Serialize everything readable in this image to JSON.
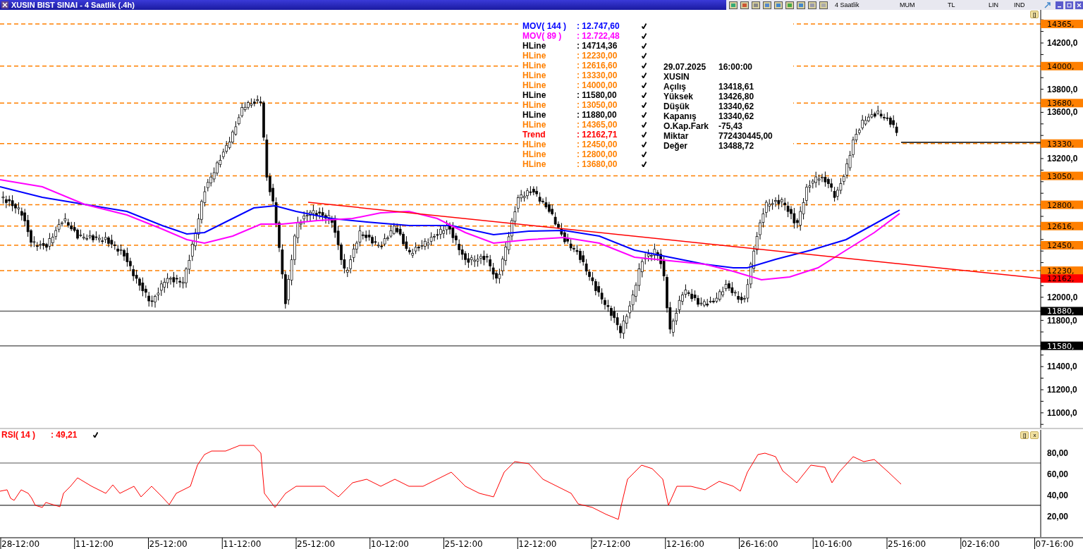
{
  "window": {
    "title": "XUSIN BIST SINAI - 4 Saatlik (.4h)"
  },
  "toolbar": {
    "items": [
      "4 Saatlik",
      "MUM",
      "TL",
      "LIN",
      "IND"
    ]
  },
  "price_panel": {
    "legend": [
      {
        "kind": "mov",
        "name": "MOV( 144 )",
        "value": ": 12.747,60",
        "color": "#0000ff"
      },
      {
        "kind": "mov",
        "name": "MOV( 89 )",
        "value": ": 12.722,48",
        "color": "#ff00ff"
      },
      {
        "kind": "hline",
        "name": "HLine",
        "value": ": 14714,36",
        "color": "#000000"
      },
      {
        "kind": "hline",
        "name": "HLine",
        "value": ": 12230,00",
        "color": "#ff8000"
      },
      {
        "kind": "hline",
        "name": "HLine",
        "value": ": 12616,60",
        "color": "#ff8000"
      },
      {
        "kind": "hline",
        "name": "HLine",
        "value": ": 13330,00",
        "color": "#ff8000"
      },
      {
        "kind": "hline",
        "name": "HLine",
        "value": ": 14000,00",
        "color": "#ff8000"
      },
      {
        "kind": "hline",
        "name": "HLine",
        "value": ": 11580,00",
        "color": "#000000"
      },
      {
        "kind": "hline",
        "name": "HLine",
        "value": ": 13050,00",
        "color": "#ff8000"
      },
      {
        "kind": "hline",
        "name": "HLine",
        "value": ": 11880,00",
        "color": "#000000"
      },
      {
        "kind": "hline",
        "name": "HLine",
        "value": ": 14365,00",
        "color": "#ff8000"
      },
      {
        "kind": "trend",
        "name": "Trend",
        "value": ": 12162,71",
        "color": "#ff0000"
      },
      {
        "kind": "hline",
        "name": "HLine",
        "value": ": 12450,00",
        "color": "#ff8000"
      },
      {
        "kind": "hline",
        "name": "HLine",
        "value": ": 12800,00",
        "color": "#ff8000"
      },
      {
        "kind": "hline",
        "name": "HLine",
        "value": ": 13680,00",
        "color": "#ff8000"
      }
    ],
    "info": [
      {
        "label": "29.07.2025",
        "value": "16:00:00"
      },
      {
        "label": "XUSIN"
      },
      {
        "label": "Açılış",
        "value": "13418,61"
      },
      {
        "label": "Yüksek",
        "value": "13426,80"
      },
      {
        "label": "Düşük",
        "value": "13340,62"
      },
      {
        "label": "Kapanış",
        "value": "13340,62"
      },
      {
        "label": "O.Kap.Fark",
        "value": "-75,43"
      },
      {
        "label": "Miktar",
        "value": "772430445,00"
      },
      {
        "label": "Değer",
        "value": "13488,72"
      }
    ],
    "panel_buttons": [
      "[]"
    ],
    "y_axis_labels": [
      "14200,0",
      "13800,0",
      "13600,0",
      "13200,0",
      "12000,0",
      "11800,0",
      "11400,0",
      "11200,0",
      "11000,0"
    ],
    "price_tags": [
      {
        "label": "14365,",
        "color": "#ff8000"
      },
      {
        "label": "14000,",
        "color": "#ff8000"
      },
      {
        "label": "13680,",
        "color": "#ff8000"
      },
      {
        "label": "13330,",
        "color": "#ff8000"
      },
      {
        "label": "13050,",
        "color": "#ff8000"
      },
      {
        "label": "12800,",
        "color": "#ff8000"
      },
      {
        "label": "12616,",
        "color": "#ff8000"
      },
      {
        "label": "12450,",
        "color": "#ff8000"
      },
      {
        "label": "12230,",
        "color": "#ff8000"
      },
      {
        "label": "12162,",
        "color": "#ff0000"
      },
      {
        "label": "11880,",
        "color": "#000000"
      },
      {
        "label": "11580,",
        "color": "#000000"
      }
    ]
  },
  "rsi_panel": {
    "legend": {
      "name": "RSI( 14 )",
      "value": ": 49,21",
      "color": "#ff0000"
    },
    "panel_buttons": [
      "[]",
      "x"
    ],
    "y_axis_labels": [
      "80,00",
      "60,00",
      "40,00",
      "20,00"
    ]
  },
  "x_axis": {
    "labels": [
      "28-12:00",
      "11-12:00",
      "25-12:00",
      "11-12:00",
      "25-12:00",
      "10-12:00",
      "25-12:00",
      "12-12:00",
      "27-12:00",
      "12-16:00",
      "26-16:00",
      "10-16:00",
      "25-16:00",
      "02-16:00",
      "07-16:00"
    ]
  }
}
